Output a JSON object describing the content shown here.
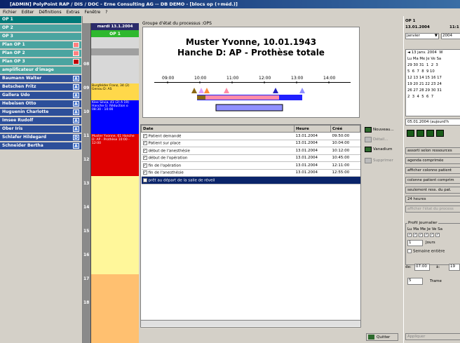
{
  "window": {
    "title": "[ADMIN] PolyPoint RAP / DIS / DOC - Erne Consulting AG  --  DB DEMO - [blocs op (+méd.)]"
  },
  "menu": [
    "Fichier",
    "Editer",
    "Définitions",
    "Extras",
    "Fenêtre",
    "?"
  ],
  "resources": [
    {
      "label": "OP 1",
      "color": "#007a78"
    },
    {
      "label": "OP 2",
      "color": "#4aa4a0"
    },
    {
      "label": "OP 3",
      "color": "#4aa4a0"
    },
    {
      "label": "Plan OP 1",
      "color": "#4aa4a0",
      "swatch": "#ff8080"
    },
    {
      "label": "Plan OP 2",
      "color": "#4aa4a0",
      "swatch": "#ff8080"
    },
    {
      "label": "Plan OP 3",
      "color": "#4aa4a0",
      "swatch": "#c00000"
    },
    {
      "label": "amplificateur d'image",
      "color": "#4aa4a0"
    },
    {
      "label": "Baumann Walter",
      "color": "#2d4f9a",
      "badge": "A"
    },
    {
      "label": "Betschen Fritz",
      "color": "#2d4f9a",
      "badge": "A"
    },
    {
      "label": "Gallera Udo",
      "color": "#2d4f9a",
      "badge": "A"
    },
    {
      "label": "Hebeisen Otto",
      "color": "#2d4f9a",
      "badge": "A"
    },
    {
      "label": "Huguenin Charlotte",
      "color": "#2d4f9a",
      "badge": "A"
    },
    {
      "label": "Imsee Rudolf",
      "color": "#2d4f9a",
      "badge": "A"
    },
    {
      "label": "Ober Iris",
      "color": "#2d4f9a",
      "badge": "A"
    },
    {
      "label": "Schlafer Hildegard",
      "color": "#2d4f9a",
      "badge": "D"
    },
    {
      "label": "Schneider Bertha",
      "color": "#2d4f9a",
      "badge": "A"
    }
  ],
  "schedule": {
    "date": "mardi 13.1.2004",
    "column": "OP 1",
    "hours": [
      "08",
      "09",
      "10",
      "11",
      "12",
      "13",
      "14",
      "15",
      "16",
      "17",
      "18"
    ],
    "blocks": [
      {
        "text": "Burgfelder Franz, 34 (2) Genou D: AS",
        "color": "#ffd84a",
        "dark": false
      },
      {
        "text": "Klee Silvia, 41 (2) A 19) Hanche G: Réduction o 08:30 - 10:00",
        "color": "#0000ff",
        "dark": true
      },
      {
        "text": "Muster Yvonne, 61 Hanche D: AP - Prothèse 10:00 - 12:00",
        "color": "#e00000",
        "dark": true
      }
    ]
  },
  "header": {
    "group_label": "Groupe d'état du processus :OPS",
    "patient": "Muster Yvonne, 10.01.1943",
    "procedure": "Hanche D: AP - Prothèse totale"
  },
  "timeline": {
    "ticks": [
      "09:00",
      "10:00",
      "11:00",
      "12:00",
      "13:00",
      "14:00"
    ]
  },
  "table": {
    "columns": [
      "Date",
      "Heure",
      "Créé"
    ],
    "rows": [
      {
        "checked": true,
        "label": "Patient demandé",
        "date": "13.01.2004",
        "time": "09:50:00"
      },
      {
        "checked": true,
        "label": "Patient sur place",
        "date": "13.01.2004",
        "time": "10:04:00"
      },
      {
        "checked": true,
        "label": "début de l'anesthésie",
        "date": "13.01.2004",
        "time": "10:12:00"
      },
      {
        "checked": true,
        "label": "début de l'opération",
        "date": "13.01.2004",
        "time": "10:45:00"
      },
      {
        "checked": true,
        "label": "fin de l'opération",
        "date": "13.01.2004",
        "time": "12:11:00"
      },
      {
        "checked": true,
        "label": "fin de l'anesthésie",
        "date": "13.01.2004",
        "time": "12:55:00"
      },
      {
        "checked": false,
        "label": "prêt au départ de la salle de réveil",
        "date": "",
        "time": "",
        "selected": true
      }
    ]
  },
  "actions": {
    "new": "Nouveau...",
    "detail": "Détail...",
    "vanadium": "Vanadium",
    "delete": "Supprimer",
    "quit": "Quitter"
  },
  "right": {
    "title": "OP 1",
    "date": "13.01.2004",
    "time": "11:1",
    "month": "janvier",
    "year": "2004",
    "cal_header": "◄ 13 janv. 2004  W",
    "cal_days": "Lu Ma Me Je Ve Sa",
    "cal_rows": [
      "29 30 31  1  2  3",
      "5  6  7  8  9 10",
      "12 13 14 15 16 17",
      "19 20 21 22 23 24",
      "26 27 28 29 30 31",
      "2  3  4  5  6  7"
    ],
    "today": "05.01.2004 (aujourd'h",
    "buttons": [
      "assorti selon ressources",
      "agenda comprimée",
      "afficher colonne patient",
      "colonne patient comprim",
      "seulement ress. du pat.",
      "24 heures",
      "afficher l'état du process"
    ],
    "profile_title": "Profil journalier",
    "profile_days": "Lu Ma Me Je Ve Sa",
    "days_value": "1",
    "days_label": "Jours",
    "week_label": "Semaine entière",
    "from_label": "de:",
    "from_value": "07:00",
    "to_label": "à:",
    "to_value": "19",
    "trame_value": "5",
    "trame_label": "Trame",
    "apply": "Appliquer"
  }
}
